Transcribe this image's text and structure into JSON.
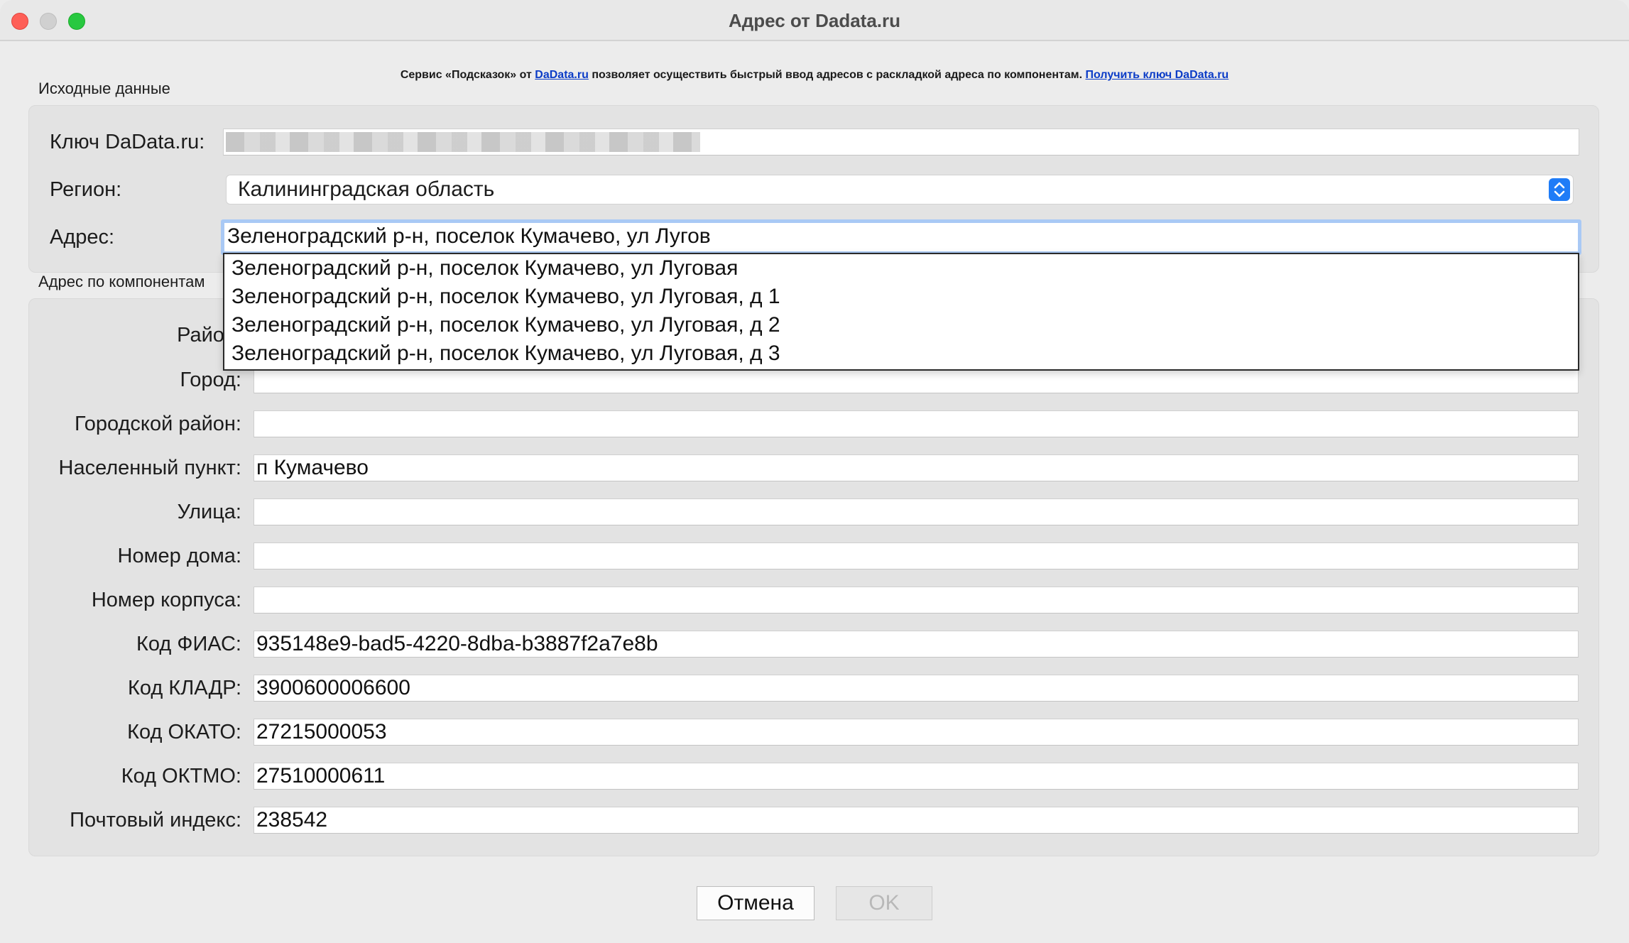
{
  "window": {
    "title": "Адрес от Dadata.ru"
  },
  "info": {
    "prefix": "Сервис «Подсказок» от ",
    "link1": "DaData.ru",
    "middle": " позволяет осуществить быстрый ввод адресов с раскладкой адреса по компонентам. ",
    "link2": "Получить ключ DaData.ru"
  },
  "source": {
    "group_label": "Исходные данные",
    "key_label": "Ключ DaData.ru:",
    "region_label": "Регион:",
    "region_value": "Калининградская область",
    "address_label": "Адрес:",
    "address_value": "Зеленоградский р-н, поселок Кумачево, ул Лугов"
  },
  "suggestions": [
    "Зеленоградский р-н, поселок Кумачево, ул Луговая",
    "Зеленоградский р-н, поселок Кумачево, ул Луговая, д 1",
    "Зеленоградский р-н, поселок Кумачево, ул Луговая, д 2",
    "Зеленоградский р-н, поселок Кумачево, ул Луговая, д 3"
  ],
  "components": {
    "group_label": "Адрес по компонентам",
    "district_label": "Район:",
    "city_label": "Город:",
    "city_value": "",
    "city_district_label": "Городской район:",
    "city_district_value": "",
    "settlement_label": "Населенный пункт:",
    "settlement_value": "п Кумачево",
    "street_label": "Улица:",
    "street_value": "",
    "house_label": "Номер дома:",
    "house_value": "",
    "block_label": "Номер корпуса:",
    "block_value": "",
    "fias_label": "Код ФИАС:",
    "fias_value": "935148e9-bad5-4220-8dba-b3887f2a7e8b",
    "kladr_label": "Код КЛАДР:",
    "kladr_value": "3900600006600",
    "okato_label": "Код ОКАТО:",
    "okato_value": "27215000053",
    "oktmo_label": "Код ОКТМО:",
    "oktmo_value": "27510000611",
    "postal_label": "Почтовый индекс:",
    "postal_value": "238542"
  },
  "buttons": {
    "cancel": "Отмена",
    "ok": "OK"
  },
  "colors": {
    "accent": "#1f7cf7",
    "focus_ring": "#a9c9f5",
    "link": "#0b3cc7"
  }
}
